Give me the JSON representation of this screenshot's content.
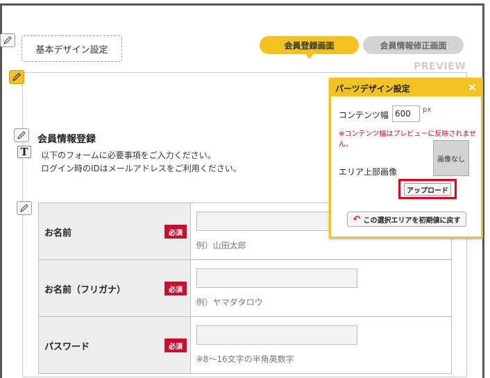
{
  "header": {
    "basic_design_button": "基本デザイン設定",
    "tabs": [
      {
        "label": "会員登録画面",
        "active": true
      },
      {
        "label": "会員情報修正画面",
        "active": false
      }
    ],
    "preview_label": "PREVIEW"
  },
  "section": {
    "title": "会員情報登録",
    "desc_line1": "以下のフォームに必要事項をご入力ください。",
    "desc_line2": "ログイン時のIDはメールアドレスをご利用ください。"
  },
  "form": {
    "required_badge": "必須",
    "rows": [
      {
        "label": "お名前",
        "hint": "例）山田太郎"
      },
      {
        "label": "お名前（フリガナ）",
        "hint": "例）ヤマダタロウ"
      },
      {
        "label": "パスワード",
        "hint": "※8～16文字の半角英数字"
      }
    ]
  },
  "popup": {
    "title": "パーツデザイン設定",
    "close": "×",
    "content_width_label": "コンテンツ幅",
    "content_width_value": "600",
    "unit": "px",
    "warning": "※コンテンツ幅はプレビューに反映されません。",
    "area_image_label": "エリア上部画像",
    "no_image": "画像なし",
    "upload_button": "アップロード",
    "reset_button": "この選択エリアを初期値に戻す"
  },
  "colors": {
    "accent": "#f2c320",
    "required": "#c8102e",
    "warning": "#e60012"
  }
}
